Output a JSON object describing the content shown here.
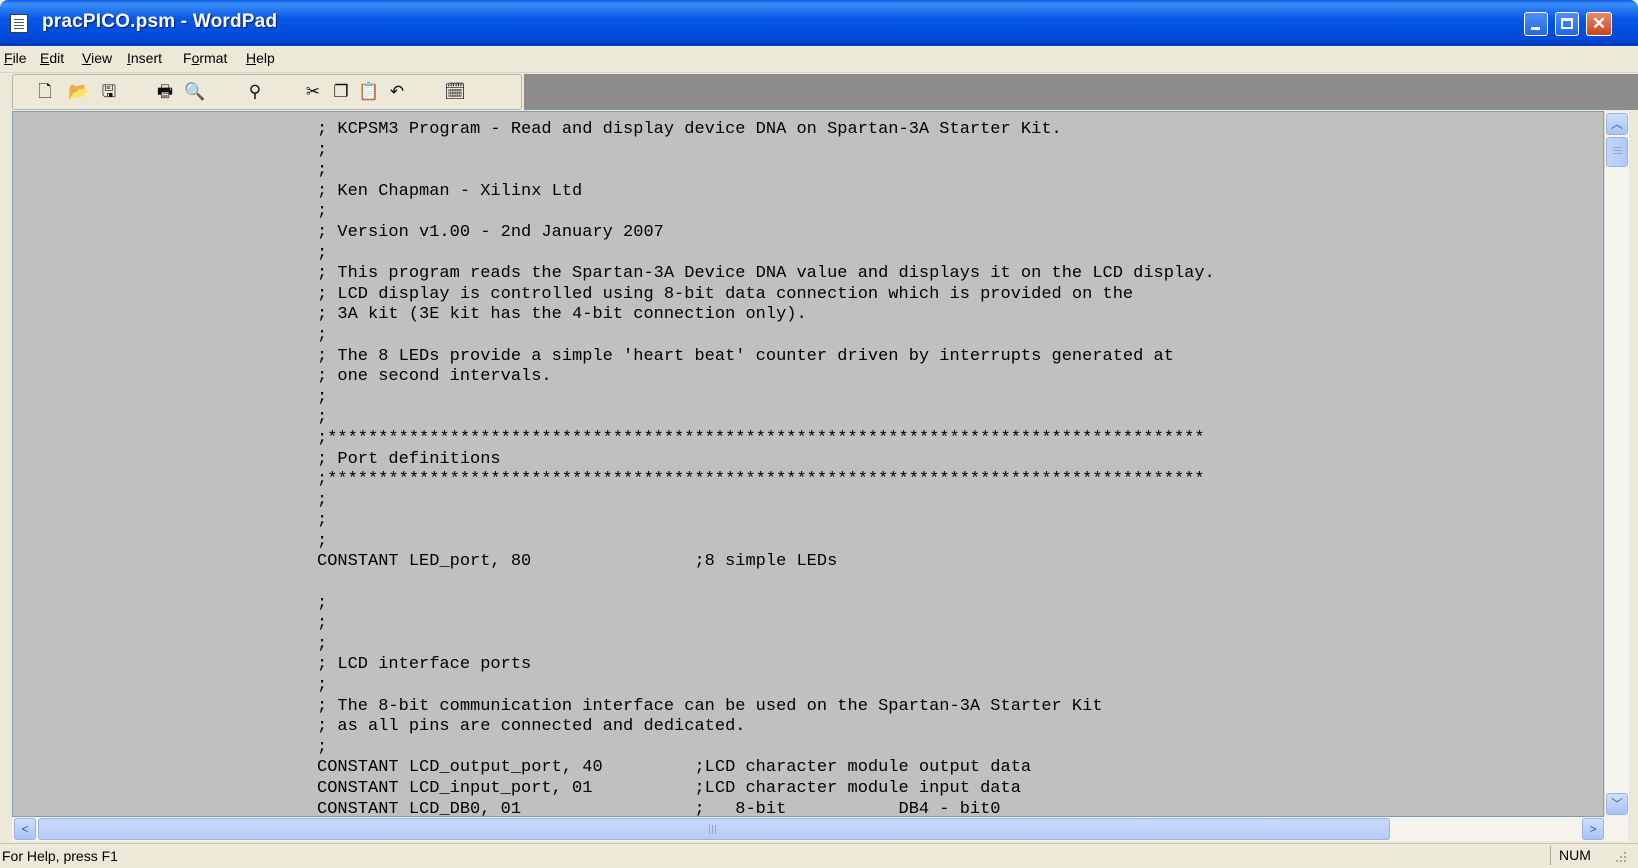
{
  "window": {
    "title": "pracPICO.psm - WordPad",
    "controls": [
      "minimize",
      "maximize",
      "close"
    ]
  },
  "menu": [
    {
      "label": "File",
      "mnemonic": "F"
    },
    {
      "label": "Edit",
      "mnemonic": "E"
    },
    {
      "label": "View",
      "mnemonic": "V"
    },
    {
      "label": "Insert",
      "mnemonic": "I"
    },
    {
      "label": "Format",
      "mnemonic": "o"
    },
    {
      "label": "Help",
      "mnemonic": "H"
    }
  ],
  "toolbar": {
    "icons": [
      "new-icon",
      "open-icon",
      "save-icon",
      "print-icon",
      "print-preview-icon",
      "find-icon",
      "cut-icon",
      "copy-icon",
      "paste-icon",
      "undo-icon",
      "date-time-icon"
    ]
  },
  "document": {
    "lines": [
      "; KCPSM3 Program - Read and display device DNA on Spartan-3A Starter Kit.",
      ";",
      ";",
      "; Ken Chapman - Xilinx Ltd",
      ";",
      "; Version v1.00 - 2nd January 2007",
      ";",
      "; This program reads the Spartan-3A Device DNA value and displays it on the LCD display.",
      "; LCD display is controlled using 8-bit data connection which is provided on the",
      "; 3A kit (3E kit has the 4-bit connection only).",
      ";",
      "; The 8 LEDs provide a simple 'heart beat' counter driven by interrupts generated at",
      "; one second intervals.",
      ";",
      ";",
      ";**************************************************************************************",
      "; Port definitions",
      ";**************************************************************************************",
      ";",
      ";",
      ";",
      "CONSTANT LED_port, 80                ;8 simple LEDs",
      "",
      ";",
      ";",
      ";",
      "; LCD interface ports",
      ";",
      "; The 8-bit communication interface can be used on the Spartan-3A Starter Kit",
      "; as all pins are connected and dedicated.",
      ";",
      "CONSTANT LCD_output_port, 40         ;LCD character module output data",
      "CONSTANT LCD_input_port, 01          ;LCD character module input data",
      "CONSTANT LCD_DB0, 01                 ;   8-bit           DB4 - bit0"
    ]
  },
  "statusbar": {
    "help_text": "For Help, press F1",
    "num_lock": "NUM"
  },
  "colors": {
    "title_bar": "#0054e3",
    "workspace_bg": "#c0c0c0",
    "chrome_bg": "#ece9d8",
    "close_button": "#d45a36"
  }
}
